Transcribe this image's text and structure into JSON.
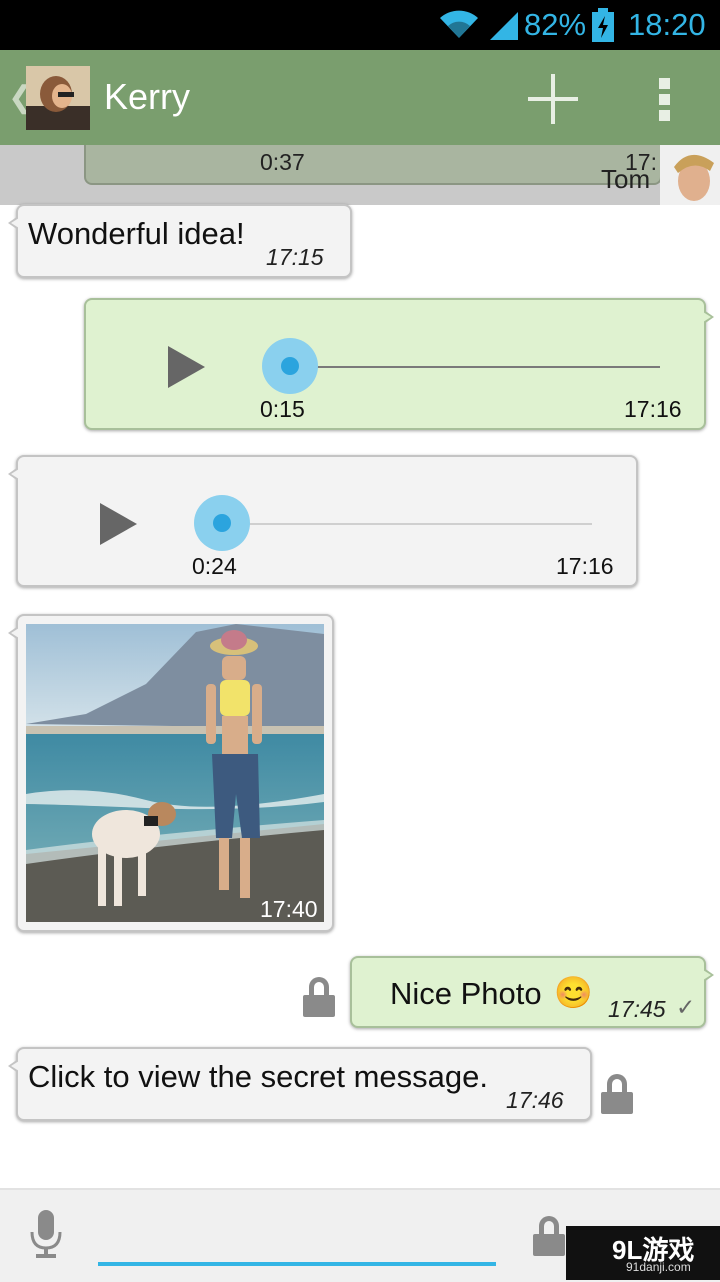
{
  "status_bar": {
    "battery": "82%",
    "time": "18:20"
  },
  "header": {
    "back_glyph": "❮",
    "contact_name": "Kerry",
    "actions": [
      "add-icon",
      "overflow-menu-icon"
    ]
  },
  "notification": {
    "duration": "0:37",
    "time": "17:",
    "sender": "Tom"
  },
  "messages": [
    {
      "direction": "in",
      "type": "text",
      "text": "Wonderful idea!",
      "time": "17:15"
    },
    {
      "direction": "out",
      "type": "audio",
      "duration": "0:15",
      "time": "17:16"
    },
    {
      "direction": "in",
      "type": "audio",
      "duration": "0:24",
      "time": "17:16"
    },
    {
      "direction": "in",
      "type": "image",
      "time": "17:40"
    },
    {
      "direction": "out",
      "type": "text",
      "text": "Nice Photo",
      "emoji": "😊",
      "time": "17:45",
      "status": "✓",
      "locked": true
    },
    {
      "direction": "in",
      "type": "text",
      "text": "Click to view the secret message.",
      "time": "17:46",
      "locked": true
    }
  ],
  "input": {
    "placeholder": ""
  },
  "watermark": {
    "brand": "9L游戏",
    "site": "91danji.com"
  },
  "colors": {
    "action_bar": "#7a9e6e",
    "outgoing_bubble": "#dff2d0",
    "incoming_bubble": "#f3f3f3",
    "accent": "#33b5e5"
  }
}
